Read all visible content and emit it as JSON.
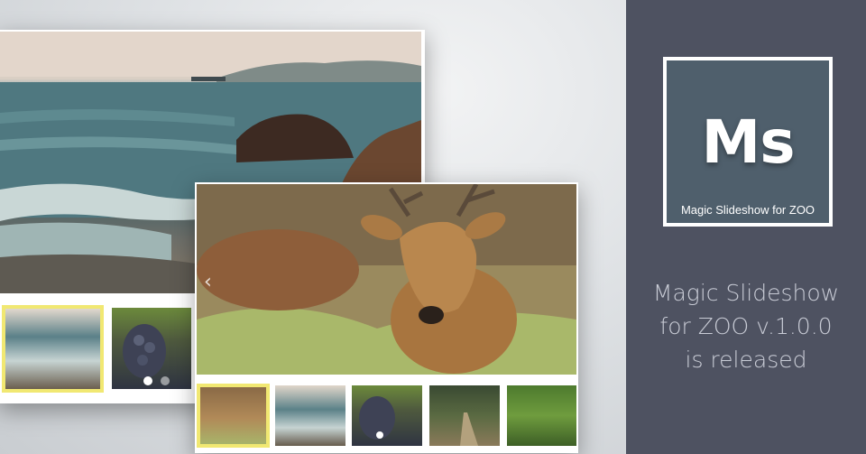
{
  "logo": {
    "letters": "Ms",
    "subtitle": "Magic Slideshow for ZOO"
  },
  "release": {
    "line1": "Magic Slideshow",
    "line2": "for ZOO v.1.0.0",
    "line3": "is released"
  },
  "icons": {
    "prev_arrow": "chevron-left-icon",
    "dots": "pagination-dot-icon"
  },
  "colors": {
    "right_panel": "#4e5261",
    "logo_box": "#4f5f6c",
    "active_thumb_border": "#f1e872",
    "release_text": "#c9ccd6"
  }
}
